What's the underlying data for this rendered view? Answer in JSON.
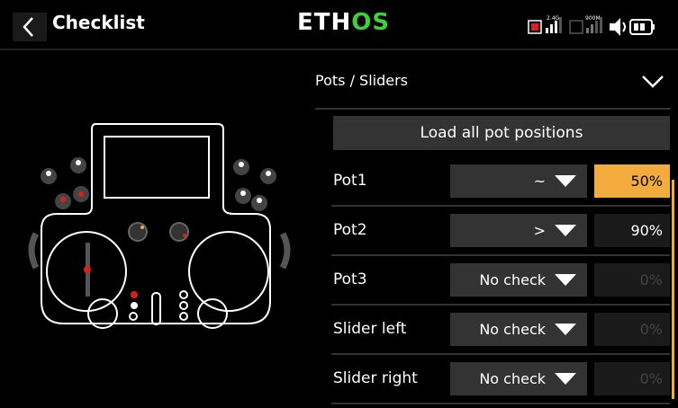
{
  "header": {
    "title": "Checklist",
    "logo_main": "ETH",
    "logo_accent": "OS"
  },
  "status": {
    "rx1_label": "2.4G",
    "rx2_label": "900M"
  },
  "section": {
    "title": "Pots / Sliders"
  },
  "load_button": {
    "label": "Load all pot positions"
  },
  "rows": [
    {
      "label": "Pot1",
      "mode": "~",
      "value": "50%",
      "state": "active"
    },
    {
      "label": "Pot2",
      "mode": ">",
      "value": "90%",
      "state": "normal"
    },
    {
      "label": "Pot3",
      "mode": "No check",
      "value": "0%",
      "state": "disabled"
    },
    {
      "label": "Slider left",
      "mode": "No check",
      "value": "0%",
      "state": "disabled"
    },
    {
      "label": "Slider right",
      "mode": "No check",
      "value": "0%",
      "state": "disabled"
    }
  ],
  "colors": {
    "accent": "#f2ac3d",
    "logo_green": "#3ecf3e",
    "row_bg": "#333333"
  },
  "icons": [
    "back-chevron-icon",
    "rx-signal-icon",
    "speaker-icon",
    "battery-icon",
    "chevron-down-icon"
  ]
}
